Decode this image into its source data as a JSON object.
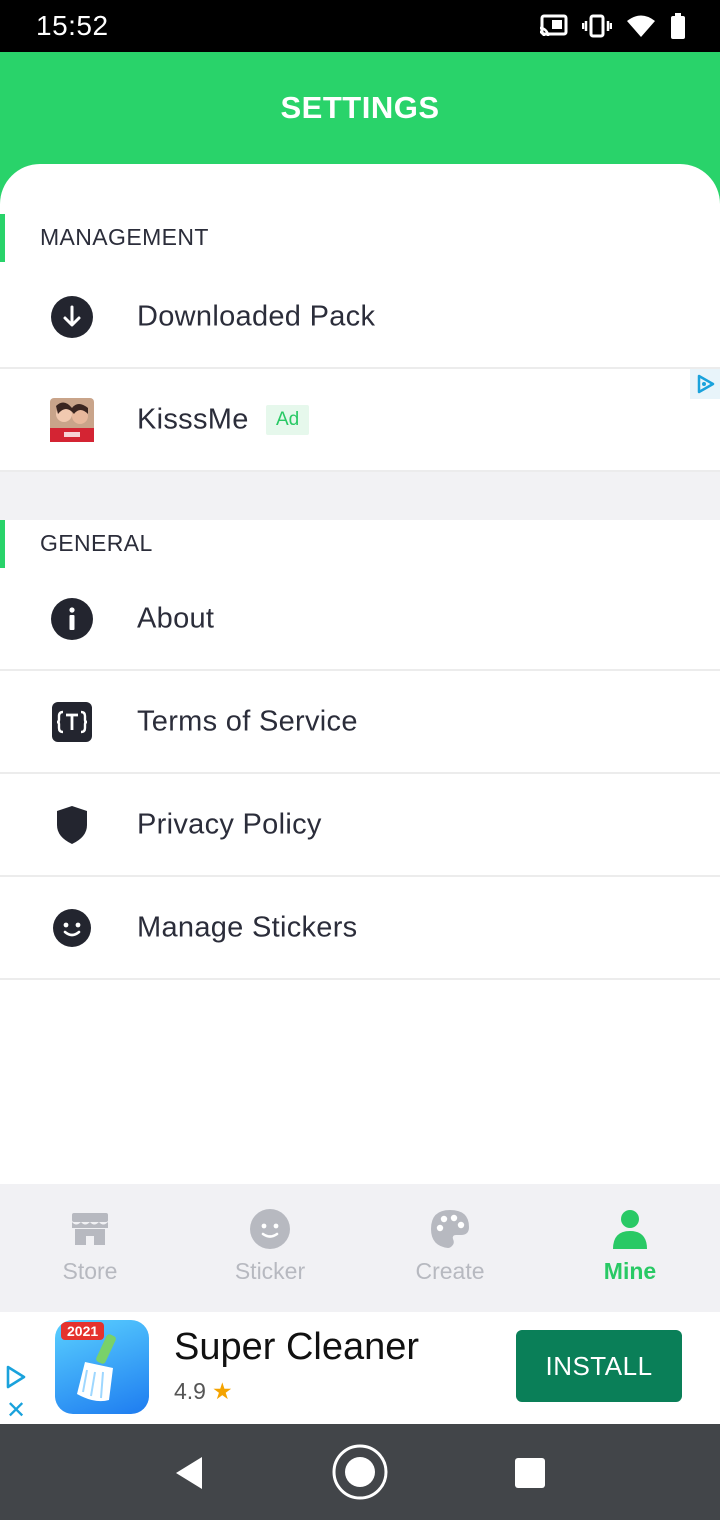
{
  "status_bar": {
    "time": "15:52"
  },
  "header": {
    "title": "SETTINGS"
  },
  "sections": {
    "management": {
      "label": "MANAGEMENT",
      "items": [
        {
          "label": "Downloaded Pack",
          "icon": "download-icon"
        }
      ],
      "ad_item": {
        "label": "KisssMe",
        "badge": "Ad",
        "icon": "kissme-app-icon"
      }
    },
    "general": {
      "label": "GENERAL",
      "items": [
        {
          "label": "About",
          "icon": "info-icon"
        },
        {
          "label": "Terms of Service",
          "icon": "terms-icon"
        },
        {
          "label": "Privacy Policy",
          "icon": "shield-icon"
        },
        {
          "label": "Manage Stickers",
          "icon": "smiley-icon"
        }
      ]
    }
  },
  "bottom_nav": {
    "items": [
      {
        "label": "Store",
        "icon": "store-icon",
        "active": false
      },
      {
        "label": "Sticker",
        "icon": "smiley-icon",
        "active": false
      },
      {
        "label": "Create",
        "icon": "palette-icon",
        "active": false
      },
      {
        "label": "Mine",
        "icon": "person-icon",
        "active": true
      }
    ]
  },
  "ad_banner": {
    "app_badge": "2021",
    "title": "Super Cleaner",
    "rating": "4.9",
    "install_label": "INSTALL"
  },
  "colors": {
    "accent": "#29d36a",
    "install": "#0a7f58",
    "nav_inactive": "#b7b9c0"
  }
}
